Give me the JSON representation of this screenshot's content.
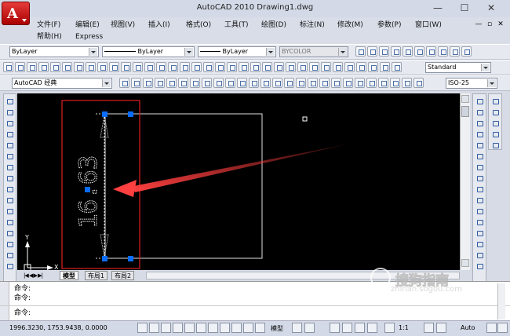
{
  "window": {
    "title": "AutoCAD 2010    Drawing1.dwg",
    "app_button": "A",
    "min": "—",
    "max": "☐",
    "close": "✕"
  },
  "menus": [
    "文件(F)",
    "编辑(E)",
    "视图(V)",
    "插入(I)",
    "格式(O)",
    "工具(T)",
    "绘图(D)",
    "标注(N)",
    "修改(M)",
    "参数(P)",
    "窗口(W)"
  ],
  "menus2": [
    "帮助(H)",
    "Express"
  ],
  "mdi_controls": [
    "—",
    "▫",
    "✕"
  ],
  "props": {
    "layer": "ByLayer",
    "color": "ByLayer",
    "linetype": "ByLayer",
    "plotstyle": "BYCOLOR"
  },
  "workspace": "AutoCAD 经典",
  "text_style": "Standard",
  "dim_style": "ISO-25",
  "drawing": {
    "dimension_text": "16.63",
    "ucs_x": "X",
    "ucs_y": "Y"
  },
  "layout_tabs": [
    "模型",
    "布局1",
    "布局2"
  ],
  "command_lines": [
    "命令:",
    "命令:",
    "命令:"
  ],
  "status": {
    "coords": "1996.3230,  1753.9438,  0.0000",
    "model": "模型",
    "scale": "1:1",
    "auto": "Auto"
  },
  "watermark": {
    "title": "搜狗指南",
    "url": "zhinan.sogou.com"
  },
  "colors": {
    "canvas": "#000000",
    "selection": "#0070ff",
    "highlight_box": "#e02020",
    "arrow": "#e84040"
  }
}
